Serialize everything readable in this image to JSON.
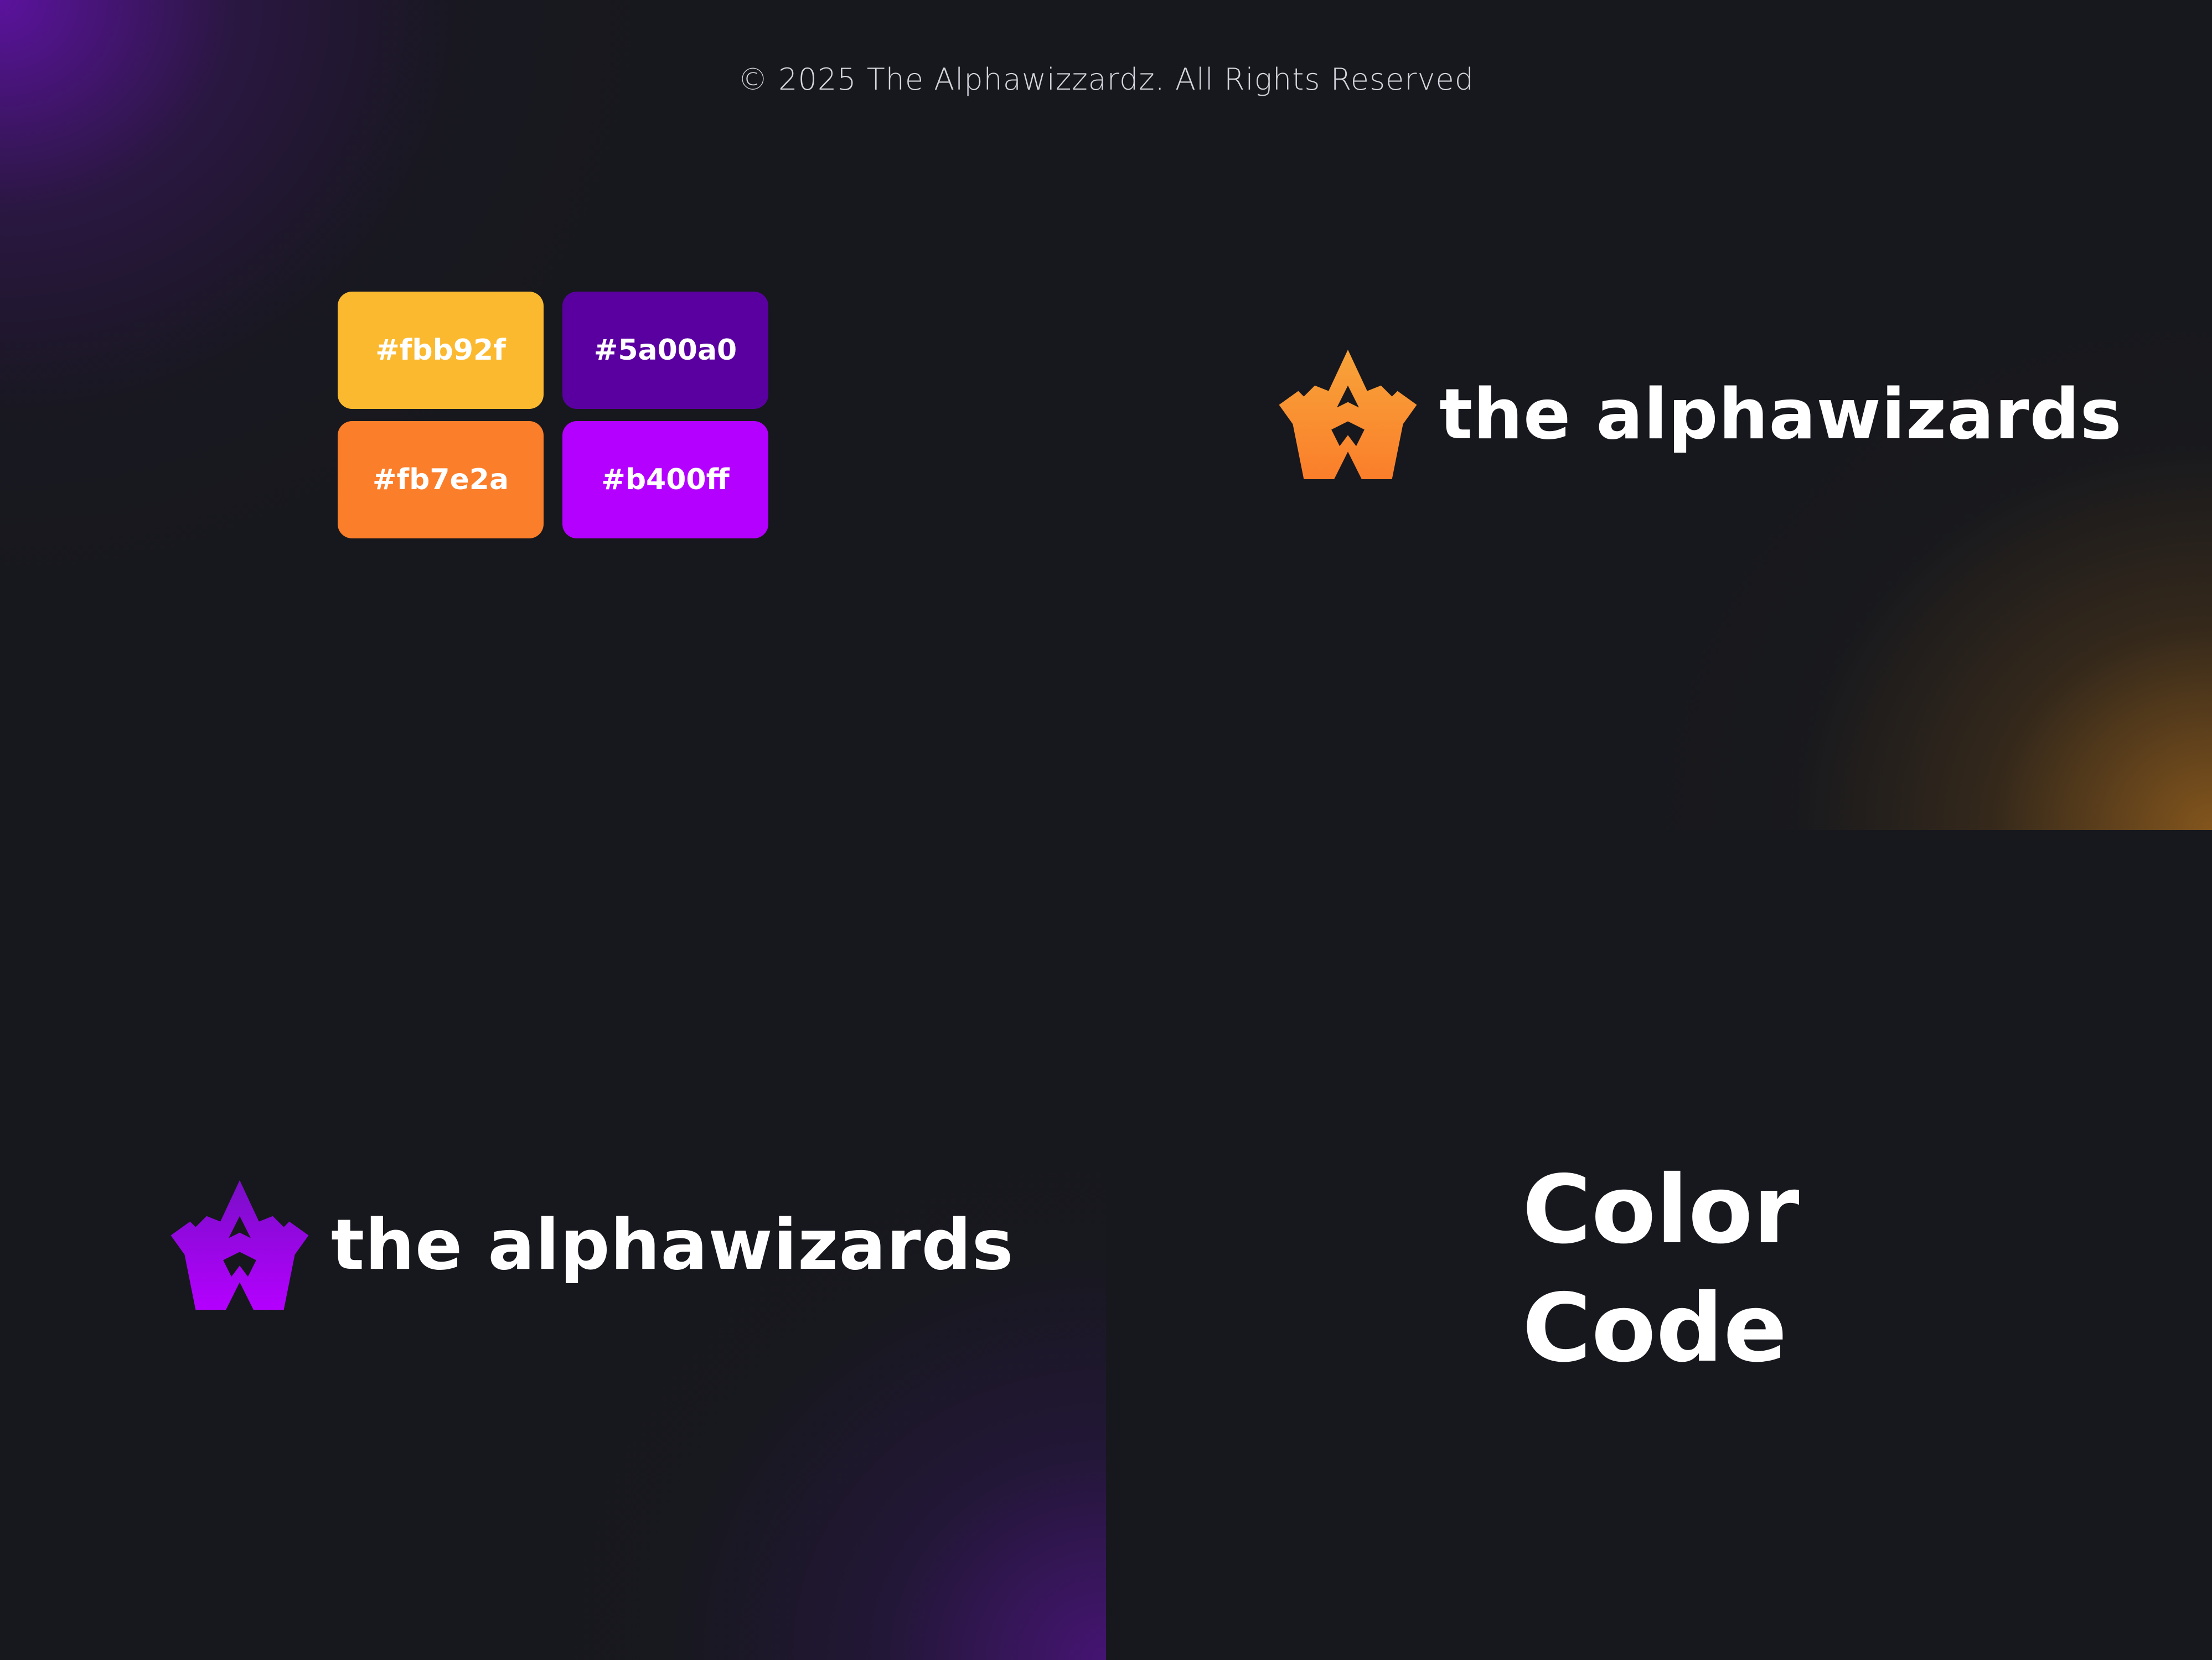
{
  "copyright": "© 2025 The Alphawizzardz. All Rights Reserved",
  "palette": [
    {
      "label": "#fbb92f",
      "color": "#fbb92f"
    },
    {
      "label": "#5a00a0",
      "color": "#5a00a0"
    },
    {
      "label": "#fb7e2a",
      "color": "#fb7e2a"
    },
    {
      "label": "#b400ff",
      "color": "#b400ff"
    }
  ],
  "logo_orange": {
    "wordmark": "the alphawizards",
    "icon": "alpha-crown-icon",
    "gradient": [
      "#f7a43a",
      "#fb7e2a"
    ]
  },
  "logo_purple": {
    "wordmark": "the alphawizards",
    "icon": "alpha-crown-icon",
    "gradient": [
      "#7a0ec8",
      "#b400ff"
    ]
  },
  "heading": {
    "line1": "Color",
    "line2": "Code"
  },
  "colors": {
    "background": "#17181d",
    "text": "#ffffff"
  }
}
